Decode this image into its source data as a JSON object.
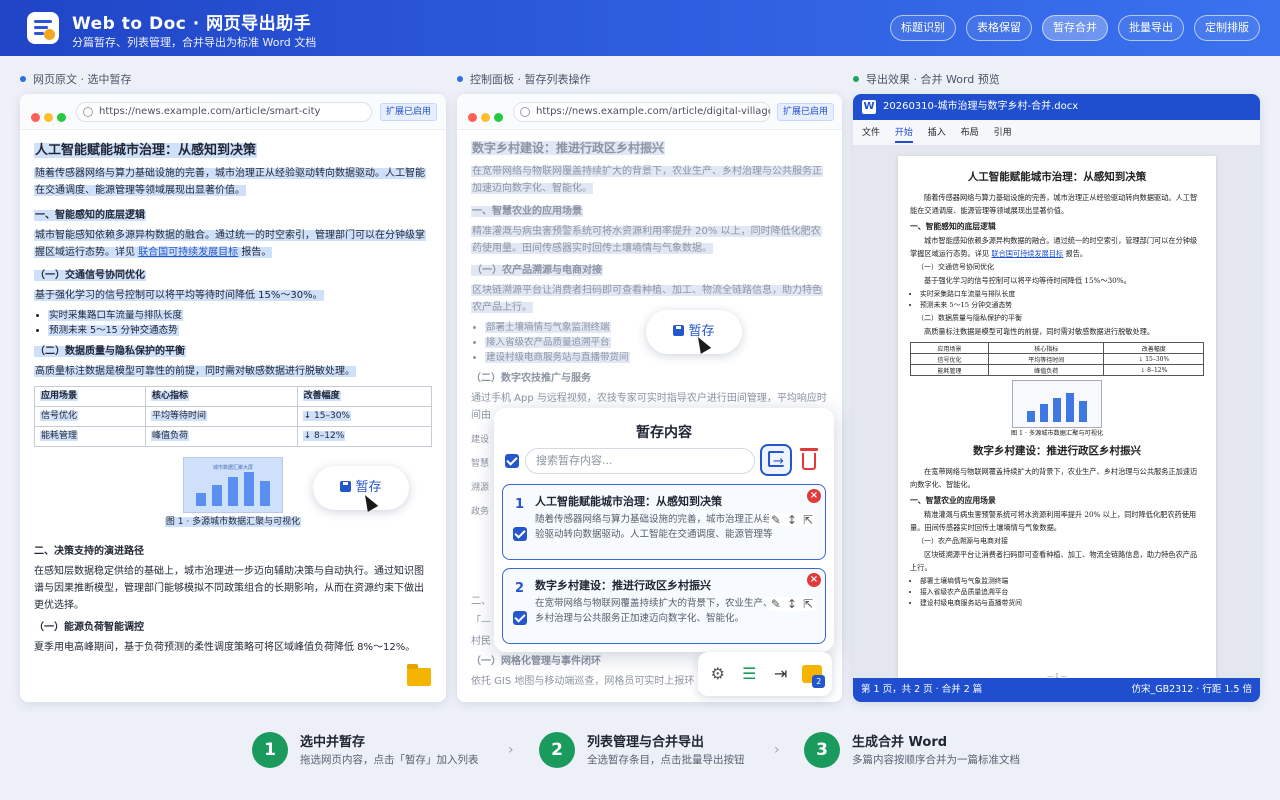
{
  "app": {
    "title": "Web to Doc · 网页导出助手",
    "subtitle": "分篇暂存、列表管理，合并导出为标准 Word 文档"
  },
  "features": [
    "标题识别",
    "表格保留",
    "暂存合并",
    "批量导出",
    "定制排版"
  ],
  "panels": {
    "left": "网页原文 · 选中暂存",
    "middle": "控制面板 · 暂存列表操作",
    "right": "导出效果 · 合并 Word 预览"
  },
  "left": {
    "url": "https://news.example.com/article/smart-city",
    "ext": "扩展已启用",
    "title": "人工智能赋能城市治理：从感知到决策",
    "p1": "随着传感器网络与算力基础设施的完善，城市治理正从经验驱动转向数据驱动。人工智能在交通调度、能源管理等领域展现出显著价值。",
    "h1": "一、智能感知的底层逻辑",
    "p2a": "城市智能感知依赖多源异构数据的融合。通过统一的时空索引，管理部门可以在分钟级掌握区域运行态势。详见 ",
    "p2link": "联合国可持续发展目标",
    "p2b": " 报告。",
    "s1": "（一）交通信号协同优化",
    "p3": "基于强化学习的信号控制可以将平均等待时间降低 15%～30%。",
    "b1": "实时采集路口车流量与排队长度",
    "b2": "预测未来 5～15 分钟交通态势",
    "s2": "（二）数据质量与隐私保护的平衡",
    "p4": "高质量标注数据是模型可靠性的前提，同时需对敏感数据进行脱敏处理。",
    "table": [
      [
        "应用场景",
        "核心指标",
        "改善幅度"
      ],
      [
        "信号优化",
        "平均等待时间",
        "↓ 15–30%"
      ],
      [
        "能耗管理",
        "峰值负荷",
        "↓ 8–12%"
      ]
    ],
    "chart_label": "城市数据汇聚大屏",
    "chart_bars": [
      0.35,
      0.55,
      0.75,
      0.9,
      0.65
    ],
    "caption": "图 1 · 多源城市数据汇聚与可视化",
    "stash": "暂存",
    "h2": "二、决策支持的演进路径",
    "p5": "在感知层数据稳定供给的基础上，城市治理进一步迈向辅助决策与自动执行。通过知识图谱与因果推断模型，管理部门能够模拟不同政策组合的长期影响，从而在资源约束下做出更优选择。",
    "s3": "（一）能源负荷智能调控",
    "p6": "夏季用电高峰期间，基于负荷预测的柔性调度策略可将区域峰值负荷降低 8%～12%。"
  },
  "middle": {
    "url": "https://news.example.com/article/digital-village",
    "ext": "扩展已启用",
    "title": "数字乡村建设：推进行政区乡村振兴",
    "p1": "在宽带网络与物联网覆盖持续扩大的背景下，农业生产、乡村治理与公共服务正加速迈向数字化、智能化。",
    "h1": "一、智慧农业的应用场景",
    "p2": "精准灌溉与病虫害预警系统可将水资源利用率提升 20% 以上，同时降低化肥农药使用量。田间传感器实时回传土壤墒情与气象数据。",
    "s1": "（一）农产品溯源与电商对接",
    "p3": "区块链溯源平台让消费者扫码即可查看种植、加工、物流全链路信息，助力特色农产品上行。",
    "b1": "部署土壤墒情与气象监测终端",
    "b2": "接入省级农产品质量追溯平台",
    "b3": "建设村级电商服务站与直播带货间",
    "s2": "（二）数字农技推广与服务",
    "p4": "通过手机 App 与远程视频，农技专家可实时指导农户进行田间管理，平均响应时间由",
    "rows": [
      "建设",
      "智慧",
      "溯源",
      "政务"
    ],
    "frag1": "二、",
    "frag2": "「—",
    "frag3": "村民",
    "s3": "（一）网格化管理与事件闭环",
    "p5": "依托 GIS 地图与移动端巡查，网格员可实时上报环",
    "stash": "暂存"
  },
  "popup": {
    "title": "暂存内容",
    "search_placeholder": "搜索暂存内容...",
    "items": [
      {
        "num": "1",
        "title": "人工智能赋能城市治理：从感知到决策",
        "body": "随着传感器网络与算力基础设施的完善，城市治理正从经验驱动转向数据驱动。人工智能在交通调度、能源管理等领域展现出显著价值。"
      },
      {
        "num": "2",
        "title": "数字乡村建设：推进行政区乡村振兴",
        "body": "在宽带网络与物联网覆盖持续扩大的背景下，农业生产、乡村治理与公共服务正加速迈向数字化、智能化。"
      }
    ],
    "tray_badge": "2"
  },
  "word": {
    "filename": "20260310-城市治理与数字乡村-合并.docx",
    "menu": [
      "文件",
      "开始",
      "插入",
      "布局",
      "引用"
    ],
    "doc1_title": "人工智能赋能城市治理：从感知到决策",
    "doc1_p1": "随着传感器网络与算力基础设施的完善，城市治理正从经验驱动转向数据驱动。人工智能在交通调度、能源管理等领域展现出显著价值。",
    "doc1_h1": "一、智能感知的底层逻辑",
    "doc1_p2a": "城市智能感知依赖多源异构数据的融合。通过统一的时空索引，管理部门可以在分钟级掌握区域运行态势。详见 ",
    "doc1_link": "联合国可持续发展目标",
    "doc1_p2b": " 报告。",
    "doc1_s1": "（一）交通信号协同优化",
    "doc1_p3": "基于强化学习的信号控制可以将平均等待时间降低 15%～30%。",
    "doc1_b1": "实时采集路口车流量与排队长度",
    "doc1_b2": "预测未来 5～15 分钟交通态势",
    "doc1_s2": "（二）数据质量与隐私保护的平衡",
    "doc1_p4": "高质量标注数据是模型可靠性的前提，同时需对敏感数据进行脱敏处理。",
    "doc1_table": [
      [
        "应用场景",
        "核心指标",
        "改善幅度"
      ],
      [
        "信号优化",
        "平均等待时间",
        "↓ 15–30%"
      ],
      [
        "能耗管理",
        "峰值负荷",
        "↓ 8–12%"
      ]
    ],
    "doc1_caption": "图 1 · 多源城市数据汇聚与可视化",
    "doc2_title": "数字乡村建设：推进行政区乡村振兴",
    "doc2_p1": "在宽带网络与物联网覆盖持续扩大的背景下，农业生产、乡村治理与公共服务正加速迈向数字化、智能化。",
    "doc2_h1": "一、智慧农业的应用场景",
    "doc2_p2": "精准灌溉与病虫害预警系统可将水资源利用率提升 20% 以上，同时降低化肥农药使用量。田间传感器实时回传土壤墒情与气象数据。",
    "doc2_s1": "（一）农产品溯源与电商对接",
    "doc2_p3": "区块链溯源平台让消费者扫码即可查看种植、加工、物流全链路信息，助力特色农产品上行。",
    "doc2_b1": "部署土壤墒情与气象监测终端",
    "doc2_b2": "接入省级农产品质量追溯平台",
    "doc2_b3": "建设村级电商服务站与直播带货间",
    "page_num": "— 1 —",
    "status_left": "第 1 页，共 2 页 · 合并 2 篇",
    "status_right": "仿宋_GB2312 · 行距 1.5 倍"
  },
  "steps": [
    {
      "num": "1",
      "title": "选中并暂存",
      "desc": "拖选网页内容，点击「暂存」加入列表"
    },
    {
      "num": "2",
      "title": "列表管理与合并导出",
      "desc": "全选暂存条目，点击批量导出按钮"
    },
    {
      "num": "3",
      "title": "生成合并 Word",
      "desc": "多篇内容按顺序合并为一篇标准文档"
    }
  ],
  "colors": {
    "brand": "#2456cc",
    "step": "#1a9a5c",
    "selection": "#cfe0fb",
    "delete": "#e23a3a"
  }
}
